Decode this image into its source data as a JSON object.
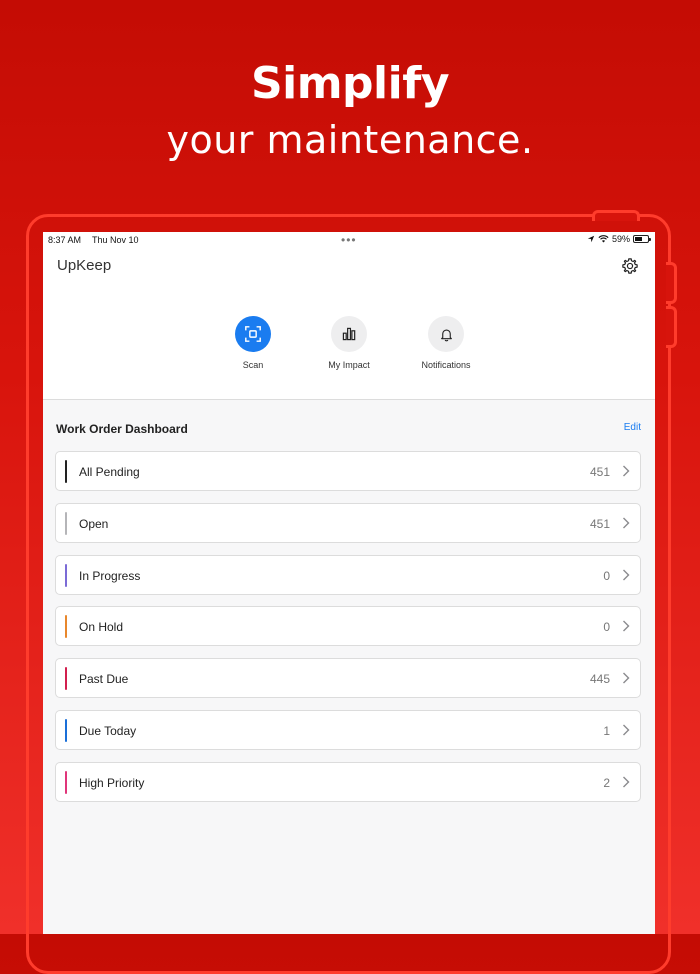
{
  "promo": {
    "headline": "Simplify",
    "subline": "your maintenance."
  },
  "status_bar": {
    "time": "8:37 AM",
    "date": "Thu Nov 10",
    "battery": "59%",
    "battery_level": 0.59
  },
  "app": {
    "title": "UpKeep",
    "settings_icon": "gear-icon"
  },
  "quick_actions": [
    {
      "label": "Scan",
      "icon": "scan-icon",
      "active": true
    },
    {
      "label": "My Impact",
      "icon": "bar-chart-icon",
      "active": false
    },
    {
      "label": "Notifications",
      "icon": "bell-icon",
      "active": false
    }
  ],
  "dashboard": {
    "title": "Work Order Dashboard",
    "edit_label": "Edit",
    "rows": [
      {
        "label": "All Pending",
        "count": "451",
        "color": "#222222"
      },
      {
        "label": "Open",
        "count": "451",
        "color": "#b5b5b8"
      },
      {
        "label": "In Progress",
        "count": "0",
        "color": "#7b6bd6"
      },
      {
        "label": "On Hold",
        "count": "0",
        "color": "#e8872c"
      },
      {
        "label": "Past Due",
        "count": "445",
        "color": "#d21f4e"
      },
      {
        "label": "Due Today",
        "count": "1",
        "color": "#1a6fd8"
      },
      {
        "label": "High Priority",
        "count": "2",
        "color": "#e0357a"
      }
    ]
  },
  "colors": {
    "accent": "#1a7cf0",
    "brand_red": "#d8140c"
  }
}
